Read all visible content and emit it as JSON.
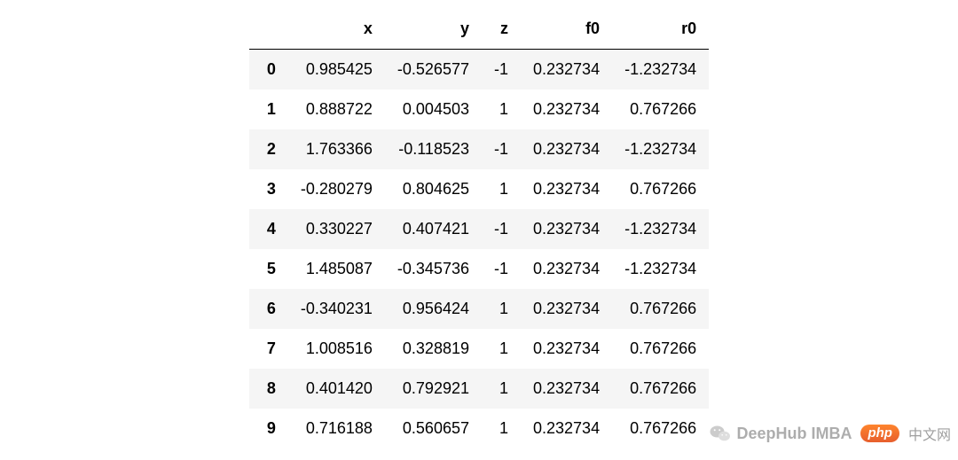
{
  "chart_data": {
    "type": "table",
    "title": "",
    "columns": [
      "x",
      "y",
      "z",
      "f0",
      "r0"
    ],
    "index": [
      "0",
      "1",
      "2",
      "3",
      "4",
      "5",
      "6",
      "7",
      "8",
      "9"
    ],
    "rows": [
      {
        "x": "0.985425",
        "y": "-0.526577",
        "z": "-1",
        "f0": "0.232734",
        "r0": "-1.232734"
      },
      {
        "x": "0.888722",
        "y": "0.004503",
        "z": "1",
        "f0": "0.232734",
        "r0": "0.767266"
      },
      {
        "x": "1.763366",
        "y": "-0.118523",
        "z": "-1",
        "f0": "0.232734",
        "r0": "-1.232734"
      },
      {
        "x": "-0.280279",
        "y": "0.804625",
        "z": "1",
        "f0": "0.232734",
        "r0": "0.767266"
      },
      {
        "x": "0.330227",
        "y": "0.407421",
        "z": "-1",
        "f0": "0.232734",
        "r0": "-1.232734"
      },
      {
        "x": "1.485087",
        "y": "-0.345736",
        "z": "-1",
        "f0": "0.232734",
        "r0": "-1.232734"
      },
      {
        "x": "-0.340231",
        "y": "0.956424",
        "z": "1",
        "f0": "0.232734",
        "r0": "0.767266"
      },
      {
        "x": "1.008516",
        "y": "0.328819",
        "z": "1",
        "f0": "0.232734",
        "r0": "0.767266"
      },
      {
        "x": "0.401420",
        "y": "0.792921",
        "z": "1",
        "f0": "0.232734",
        "r0": "0.767266"
      },
      {
        "x": "0.716188",
        "y": "0.560657",
        "z": "1",
        "f0": "0.232734",
        "r0": "0.767266"
      }
    ]
  },
  "watermark": {
    "brand1": "DeepHub IMBA",
    "brand2": "php",
    "brand3": "中文网"
  }
}
